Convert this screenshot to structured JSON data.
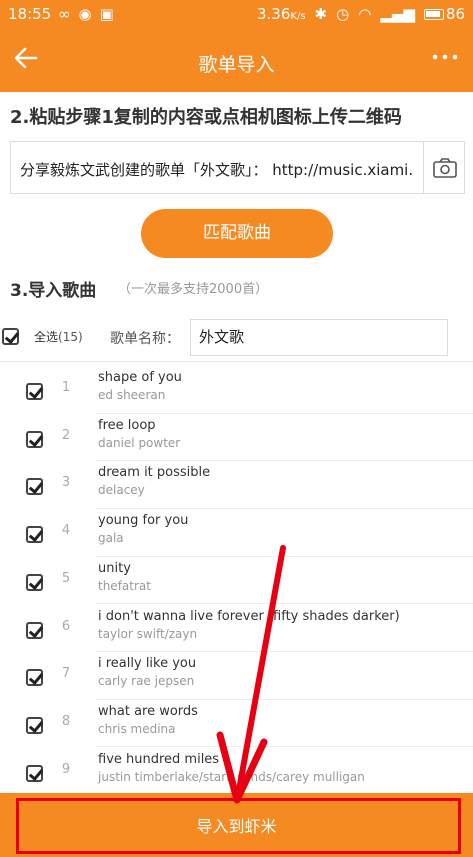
{
  "status": {
    "time": "18:55",
    "left_icons": [
      "infinity-icon",
      "circle-icon",
      "image-icon"
    ],
    "speed": "3.36",
    "speed_unit": "K/s",
    "battery": "86"
  },
  "appbar": {
    "title": "歌单导入",
    "back_icon": "back-arrow-icon",
    "more_icon": "more-icon"
  },
  "step2": {
    "label": "2.粘贴步骤1复制的内容或点相机图标上传二维码",
    "paste_text": "分享毅炼文武创建的歌单「外文歌」： http://music.xiami.com",
    "camera_icon": "camera-icon"
  },
  "match_button": "匹配歌曲",
  "step3": {
    "label": "3.导入歌曲",
    "note": "（一次最多支持2000首）"
  },
  "select": {
    "all_label": "全选",
    "count": "(15)",
    "name_label": "歌单名称：",
    "name_value": "外文歌"
  },
  "songs": [
    {
      "num": "1",
      "title": "shape of you",
      "artist": "ed sheeran"
    },
    {
      "num": "2",
      "title": "free loop",
      "artist": "daniel powter"
    },
    {
      "num": "3",
      "title": "dream it possible",
      "artist": "delacey"
    },
    {
      "num": "4",
      "title": "young for you",
      "artist": "gala"
    },
    {
      "num": "5",
      "title": "unity",
      "artist": "thefatrat"
    },
    {
      "num": "6",
      "title": "i don't wanna live forever (fifty shades darker)",
      "artist": "taylor swift/zayn"
    },
    {
      "num": "7",
      "title": "i really like you",
      "artist": "carly rae jepsen"
    },
    {
      "num": "8",
      "title": "what are words",
      "artist": "chris medina"
    },
    {
      "num": "9",
      "title": "five hundred miles",
      "artist": "justin timberlake/stark sands/carey mulligan"
    }
  ],
  "bottom_button": "导入到虾米",
  "colors": {
    "accent": "#f58a23",
    "highlight": "#e60012"
  }
}
